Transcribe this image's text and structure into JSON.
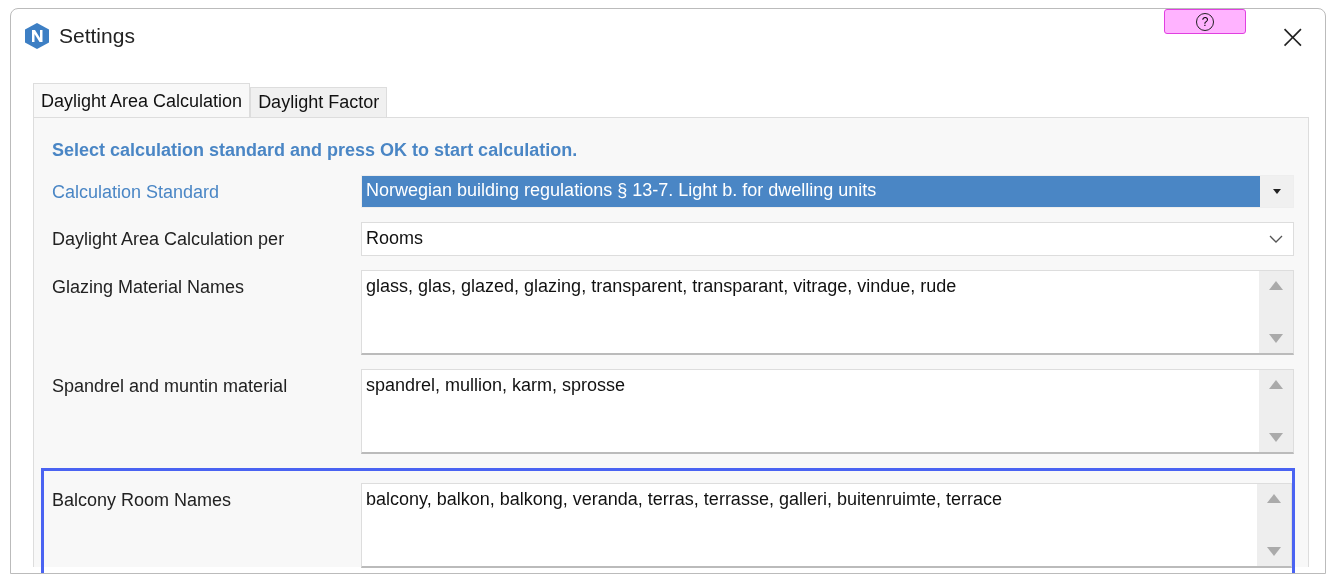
{
  "window": {
    "title": "Settings",
    "help_button": "?",
    "close_button": "×"
  },
  "tabs": [
    {
      "label": "Daylight Area Calculation",
      "selected": true
    },
    {
      "label": "Daylight Factor",
      "selected": false
    }
  ],
  "heading": "Select calculation standard and press OK to start calculation.",
  "rows": [
    {
      "label": "Calculation Standard",
      "kind": "combo",
      "value": "Norwegian building regulations § 13-7. Light b. for dwelling units",
      "selected": true,
      "outlined": false
    },
    {
      "label": "Daylight Area Calculation per",
      "kind": "dropdown",
      "value": "Rooms",
      "selected": false,
      "outlined": false
    },
    {
      "label": "Glazing Material Names",
      "kind": "textarea",
      "value": "glass, glas, glazed, glazing, transparent, transparant, vitrage, vindue, rude",
      "selected": false,
      "outlined": false
    },
    {
      "label": "Spandrel and muntin material",
      "kind": "textarea",
      "value": "spandrel, mullion, karm, sprosse",
      "selected": false,
      "outlined": false
    },
    {
      "label": "Balcony Room Names",
      "kind": "textarea",
      "value": "balcony, balkon, balkong, veranda, terras, terrasse, galleri, buitenruimte, terrace",
      "selected": false,
      "outlined": true
    }
  ]
}
